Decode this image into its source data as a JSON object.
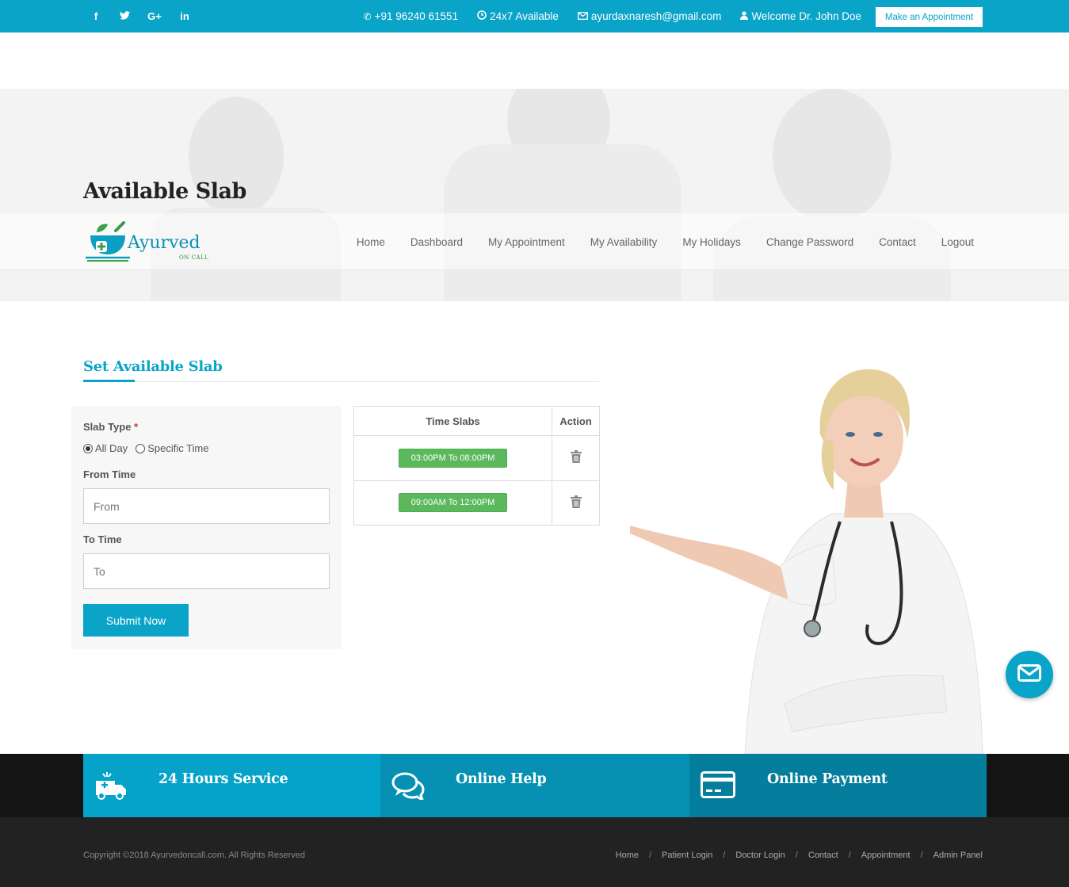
{
  "topbar": {
    "phone": "+91 96240 61551",
    "availability": "24x7 Available",
    "email": "ayurdaxnaresh@gmail.com",
    "welcome": "Welcome Dr. John Doe",
    "appointment_button": "Make an Appointment",
    "social_icons": [
      "facebook-icon",
      "twitter-icon",
      "google-plus-icon",
      "linkedin-icon"
    ]
  },
  "page": {
    "title": "Available Slab"
  },
  "logo": {
    "name": "Ayurved",
    "tagline": "ON CALL"
  },
  "nav": {
    "items": [
      "Home",
      "Dashboard",
      "My Appointment",
      "My Availability",
      "My Holidays",
      "Change Password",
      "Contact",
      "Logout"
    ]
  },
  "section": {
    "title": "Set Available Slab"
  },
  "form": {
    "slab_type_label": "Slab Type",
    "required_mark": "*",
    "options": [
      "All Day",
      "Specific Time"
    ],
    "selected_option": "All Day",
    "from_label": "From Time",
    "from_placeholder": "From",
    "to_label": "To Time",
    "to_placeholder": "To",
    "submit_label": "Submit Now"
  },
  "table": {
    "headers": [
      "Time Slabs",
      "Action"
    ],
    "rows": [
      {
        "slab": "03:00PM To 08:00PM",
        "action": "delete-icon"
      },
      {
        "slab": "09:00AM To 12:00PM",
        "action": "delete-icon"
      }
    ]
  },
  "features": [
    {
      "title": "24 Hours Service",
      "icon": "ambulance-icon",
      "color": "#05a2c9"
    },
    {
      "title": "Online Help",
      "icon": "chat-icon",
      "color": "#0691b4"
    },
    {
      "title": "Online Payment",
      "icon": "credit-card-icon",
      "color": "#047e9c"
    }
  ],
  "footer": {
    "copyright": "Copyright ©2018 Ayurvedoncall.com. All Rights Reserved",
    "links": [
      "Home",
      "Patient Login",
      "Doctor Login",
      "Contact",
      "Appointment",
      "Admin Panel"
    ],
    "separator": "/"
  },
  "colors": {
    "accent": "#0aa4c8",
    "success": "#5cb85c",
    "dark": "#222222"
  }
}
